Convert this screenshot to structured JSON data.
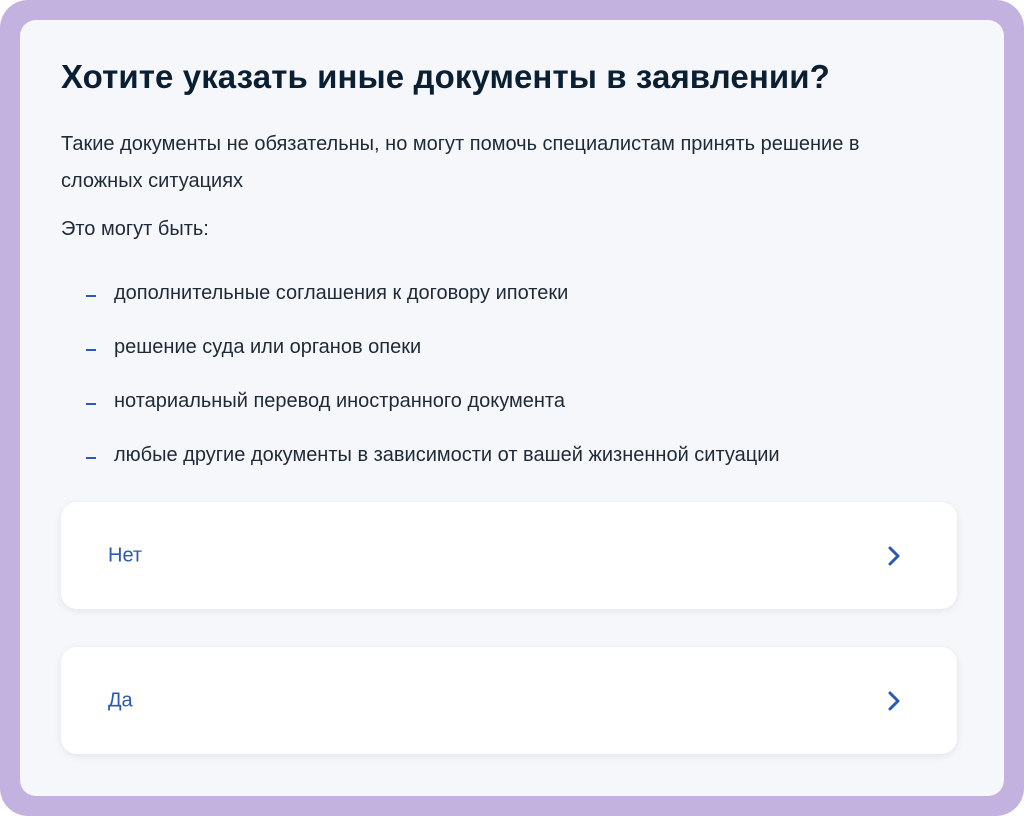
{
  "question": {
    "title": "Хотите указать иные документы в заявлении?",
    "description": "Такие документы не обязательны, но могут помочь специалистам принять решение в сложных ситуациях",
    "intro": "Это могут быть:",
    "items": [
      "дополнительные соглашения к договору ипотеки",
      "решение суда или органов опеки",
      "нотариальный перевод иностранного документа",
      "любые другие документы в зависимости от вашей жизненной ситуации"
    ]
  },
  "options": {
    "no_label": "Нет",
    "yes_label": "Да",
    "icon": "chevron-right-icon"
  },
  "colors": {
    "frame": "#c3b2e0",
    "panel_background": "#f5f7fb",
    "accent": "#2a5ab3",
    "text": "#0b1f33"
  }
}
